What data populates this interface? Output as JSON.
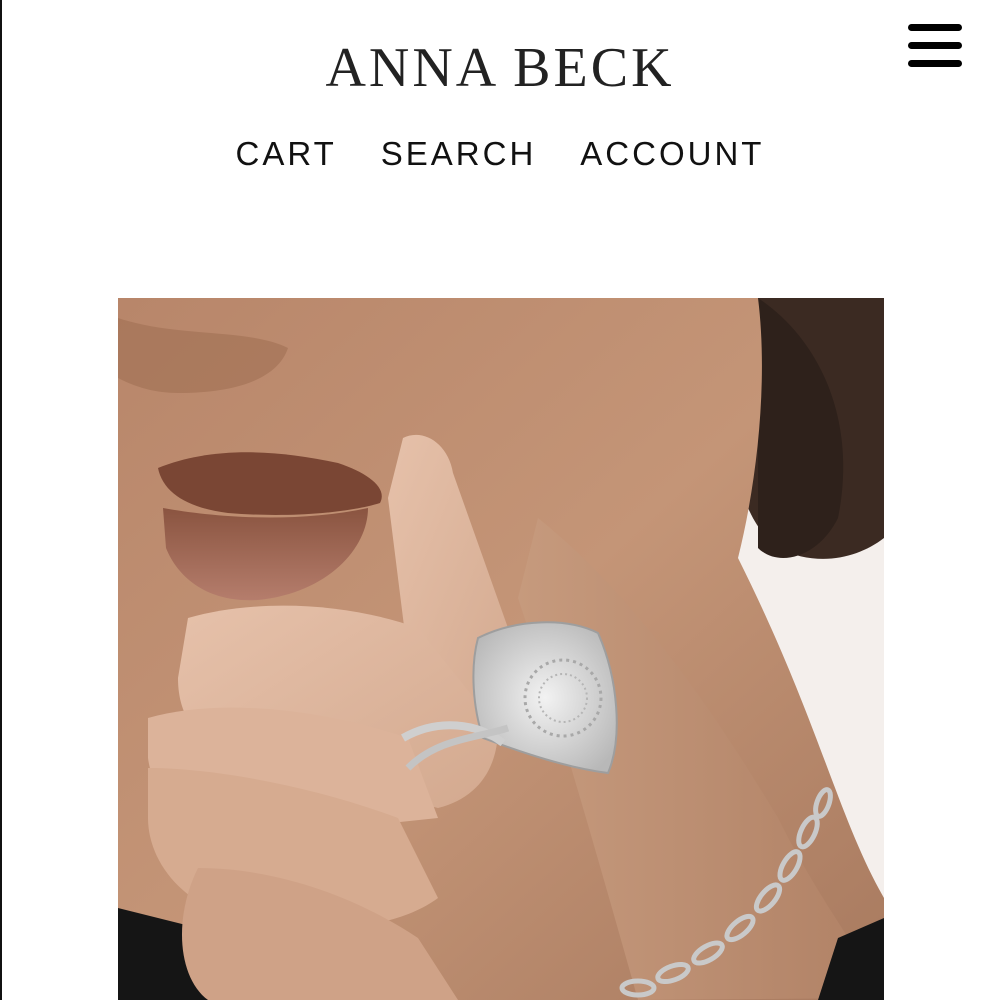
{
  "header": {
    "brand": "ANNA BECK",
    "menu_icon": "hamburger-menu-icon"
  },
  "nav": {
    "cart_label": "CART",
    "search_label": "SEARCH",
    "account_label": "ACCOUNT"
  },
  "hero": {
    "image_subject": "model-with-silver-rings-and-chain-necklace"
  },
  "colors": {
    "text": "#111111",
    "brand": "#222222",
    "background": "#ffffff",
    "silver": "#cfcfcf"
  }
}
